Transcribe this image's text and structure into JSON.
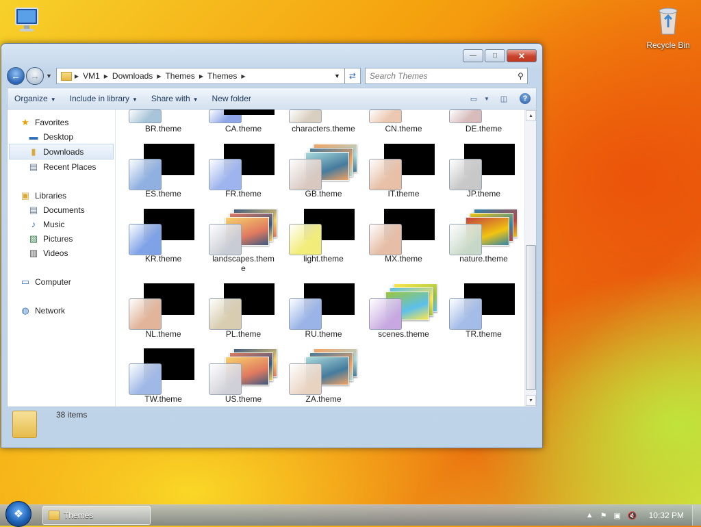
{
  "desktop": {
    "recycle_bin_label": "Recycle Bin"
  },
  "window": {
    "title": "Themes",
    "controls": {
      "minimize": "—",
      "maximize": "□",
      "close": "✕"
    }
  },
  "address_bar": {
    "crumbs": [
      "VM1",
      "Downloads",
      "Themes",
      "Themes"
    ]
  },
  "search": {
    "placeholder": "Search Themes"
  },
  "toolbar": {
    "organize": "Organize",
    "include_in_library": "Include in library",
    "share_with": "Share with",
    "new_folder": "New folder",
    "help": "?"
  },
  "nav": {
    "favorites": "Favorites",
    "desktop": "Desktop",
    "downloads": "Downloads",
    "recent_places": "Recent Places",
    "libraries": "Libraries",
    "documents": "Documents",
    "music": "Music",
    "pictures": "Pictures",
    "videos": "Videos",
    "computer": "Computer",
    "network": "Network"
  },
  "files": [
    {
      "label": "BR.theme",
      "kind": "cropped"
    },
    {
      "label": "CA.theme",
      "kind": "cropped"
    },
    {
      "label": "characters.theme",
      "kind": "cropped"
    },
    {
      "label": "CN.theme",
      "kind": "cropped"
    },
    {
      "label": "DE.theme",
      "kind": "cropped"
    },
    {
      "label": "ES.theme",
      "kind": "solid",
      "glass": "#8fb0e0"
    },
    {
      "label": "FR.theme",
      "kind": "solid",
      "glass": "#9eb4ee"
    },
    {
      "label": "GB.theme",
      "kind": "photos",
      "glass": "#d8c8c0"
    },
    {
      "label": "IT.theme",
      "kind": "solid",
      "glass": "#e8c0a8"
    },
    {
      "label": "JP.theme",
      "kind": "solid",
      "glass": "#c8c8c8"
    },
    {
      "label": "KR.theme",
      "kind": "solid",
      "glass": "#7fa2e6"
    },
    {
      "label": "landscapes.theme",
      "kind": "photos",
      "glass": "#c8ccd4"
    },
    {
      "label": "light.theme",
      "kind": "solid",
      "glass": "#f2ec7a"
    },
    {
      "label": "MX.theme",
      "kind": "solid",
      "glass": "#e6bda6"
    },
    {
      "label": "nature.theme",
      "kind": "photos",
      "glass": "#c8d8c8"
    },
    {
      "label": "NL.theme",
      "kind": "solid",
      "glass": "#e2b49a"
    },
    {
      "label": "PL.theme",
      "kind": "solid",
      "glass": "#d8cdb0"
    },
    {
      "label": "RU.theme",
      "kind": "solid",
      "glass": "#9ab4e8"
    },
    {
      "label": "scenes.theme",
      "kind": "photos",
      "glass": "#c8a8e0"
    },
    {
      "label": "TR.theme",
      "kind": "solid",
      "glass": "#a4bce8"
    },
    {
      "label": "TW.theme",
      "kind": "solid",
      "glass": "#9fb8e6"
    },
    {
      "label": "US.theme",
      "kind": "photos",
      "glass": "#d0d0d8"
    },
    {
      "label": "ZA.theme",
      "kind": "photos",
      "glass": "#e8d2c0"
    }
  ],
  "status": {
    "item_count": "38 items"
  },
  "taskbar": {
    "task_label": "Themes",
    "clock": "10:32 PM"
  }
}
